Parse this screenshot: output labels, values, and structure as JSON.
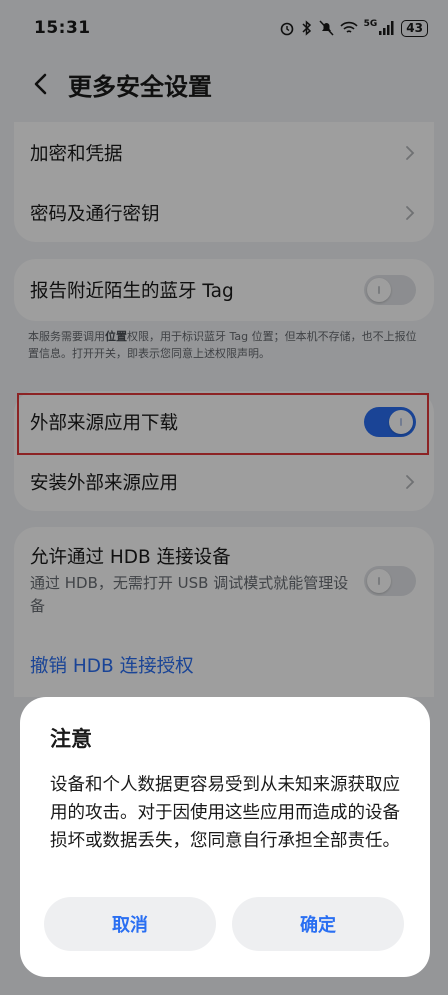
{
  "status_bar": {
    "time": "15:31",
    "network": "5G",
    "battery": "43"
  },
  "header": {
    "title": "更多安全设置"
  },
  "group1": {
    "items": [
      {
        "label": "加密和凭据"
      },
      {
        "label": "密码及通行密钥"
      }
    ]
  },
  "bluetooth_tag": {
    "label": "报告附近陌生的蓝牙 Tag",
    "enabled": false,
    "note_prefix": "本服务需要调用",
    "note_bold": "位置",
    "note_suffix": "权限，用于标识蓝牙 Tag 位置；但本机不存储，也不上报位置信息。打开开关，即表示您同意上述权限声明。"
  },
  "external_sources": {
    "download_label": "外部来源应用下载",
    "download_enabled": true,
    "install_label": "安装外部来源应用"
  },
  "hdb": {
    "label": "允许通过 HDB 连接设备",
    "subtext": "通过 HDB，无需打开 USB 调试模式就能管理设备",
    "enabled": false,
    "revoke_label": "撤销 HDB 连接授权"
  },
  "dialog": {
    "title": "注意",
    "body": "设备和个人数据更容易受到从未知来源获取应用的攻击。对于因使用这些应用而造成的设备损坏或数据丢失，您同意自行承担全部责任。",
    "cancel_label": "取消",
    "confirm_label": "确定"
  },
  "colors": {
    "accent": "#2a6ff2",
    "highlight": "#e2393b",
    "background": "#f1f3f5"
  }
}
